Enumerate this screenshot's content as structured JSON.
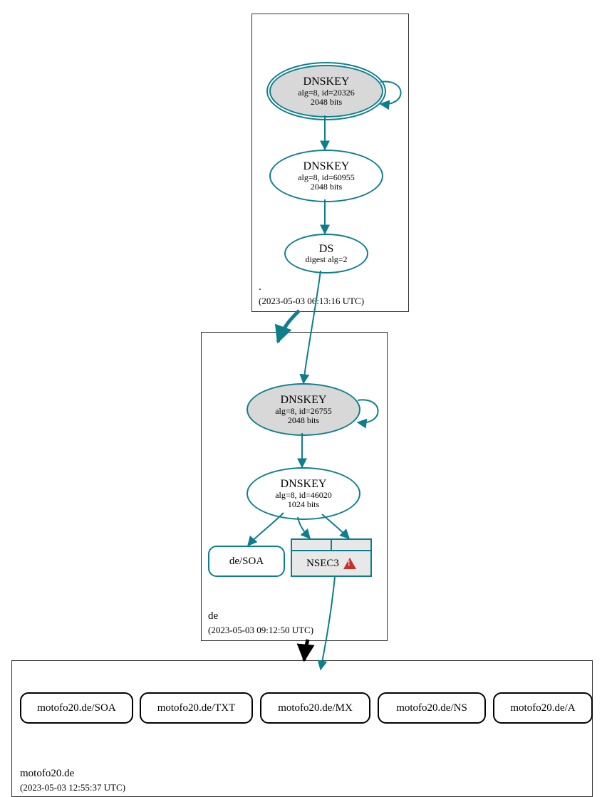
{
  "colors": {
    "teal": "#0e7e8c",
    "nodeFill": "#d8d8d8",
    "black": "#000000",
    "warn": "#c9302c"
  },
  "zones": {
    "root": {
      "name": ".",
      "timestamp": "(2023-05-03 06:13:16 UTC)"
    },
    "de": {
      "name": "de",
      "timestamp": "(2023-05-03 09:12:50 UTC)"
    },
    "leaf": {
      "name": "motofo20.de",
      "timestamp": "(2023-05-03 12:55:37 UTC)"
    }
  },
  "nodes": {
    "rootKsk": {
      "title": "DNSKEY",
      "line1": "alg=8, id=20326",
      "line2": "2048 bits"
    },
    "rootZsk": {
      "title": "DNSKEY",
      "line1": "alg=8, id=60955",
      "line2": "2048 bits"
    },
    "rootDs": {
      "title": "DS",
      "line1": "digest alg=2"
    },
    "deKsk": {
      "title": "DNSKEY",
      "line1": "alg=8, id=26755",
      "line2": "2048 bits"
    },
    "deZsk": {
      "title": "DNSKEY",
      "line1": "alg=8, id=46020",
      "line2": "1024 bits"
    },
    "deSoa": {
      "label": "de/SOA"
    },
    "nsec3": {
      "label": "NSEC3"
    }
  },
  "leafRecords": [
    {
      "label": "motofo20.de/SOA"
    },
    {
      "label": "motofo20.de/TXT"
    },
    {
      "label": "motofo20.de/MX"
    },
    {
      "label": "motofo20.de/NS"
    },
    {
      "label": "motofo20.de/A"
    }
  ]
}
